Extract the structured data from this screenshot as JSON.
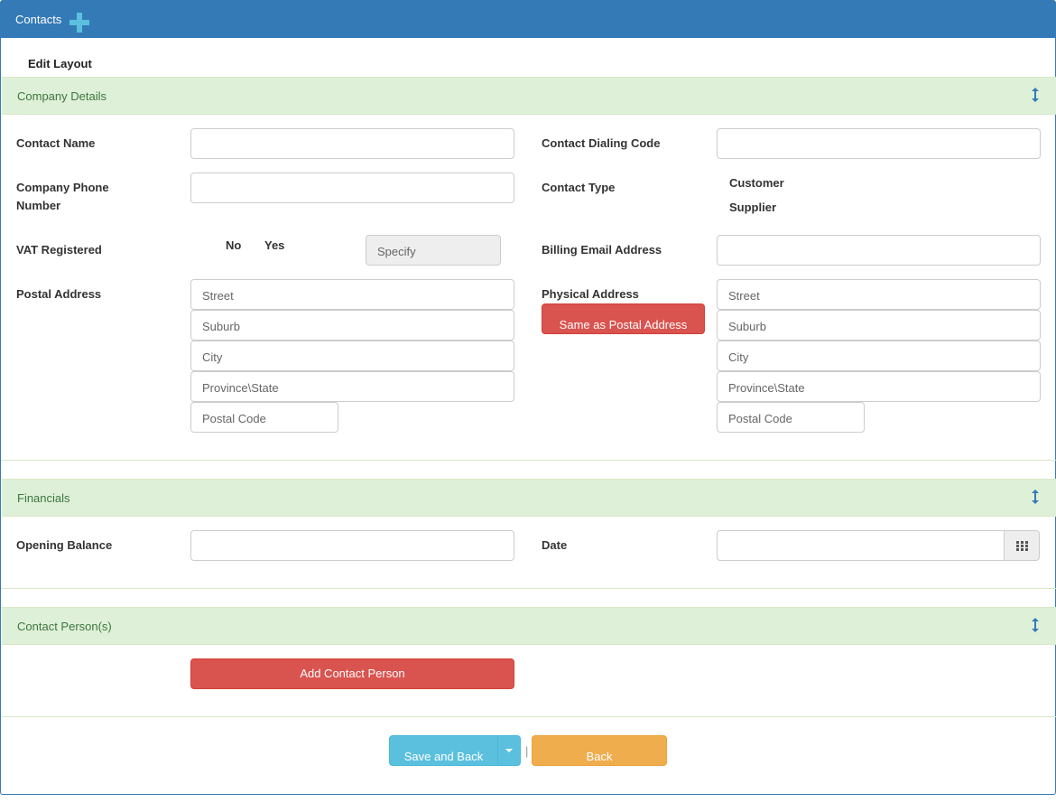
{
  "header": {
    "title": "Contacts",
    "add_icon": "plus-icon",
    "accent_color": "#337ab7"
  },
  "edit_layout": "Edit Layout",
  "sections": {
    "company": {
      "title": "Company Details",
      "icon": "resize-vertical-icon"
    },
    "financials": {
      "title": "Financials",
      "icon": "resize-vertical-icon"
    },
    "persons": {
      "title": "Contact Person(s)",
      "icon": "resize-vertical-icon"
    }
  },
  "company": {
    "contact_name": {
      "label": "Contact Name",
      "value": ""
    },
    "dialing_code": {
      "label": "Contact Dialing Code",
      "value": ""
    },
    "phone": {
      "label_line1": "Company Phone",
      "label_line2": "Number",
      "value": ""
    },
    "contact_type": {
      "label": "Contact Type",
      "options": [
        "Customer",
        "Supplier"
      ]
    },
    "vat": {
      "label": "VAT Registered",
      "options": [
        "No",
        "Yes"
      ],
      "specify_placeholder": "Specify"
    },
    "billing_email": {
      "label": "Billing Email Address",
      "value": ""
    },
    "postal": {
      "label": "Postal Address",
      "street": "Street",
      "suburb": "Suburb",
      "city": "City",
      "province": "Province\\State",
      "postal_code": "Postal Code"
    },
    "physical": {
      "label": "Physical Address",
      "same_button": "Same as Postal Address",
      "street": "Street",
      "suburb": "Suburb",
      "city": "City",
      "province": "Province\\State",
      "postal_code": "Postal Code"
    }
  },
  "financials": {
    "opening_balance": {
      "label": "Opening Balance",
      "value": ""
    },
    "date": {
      "label": "Date",
      "value": "",
      "icon": "calendar-icon"
    }
  },
  "persons": {
    "add_button": "Add Contact Person"
  },
  "footer": {
    "save_back": "Save and Back",
    "separator": "|",
    "back": "Back"
  }
}
